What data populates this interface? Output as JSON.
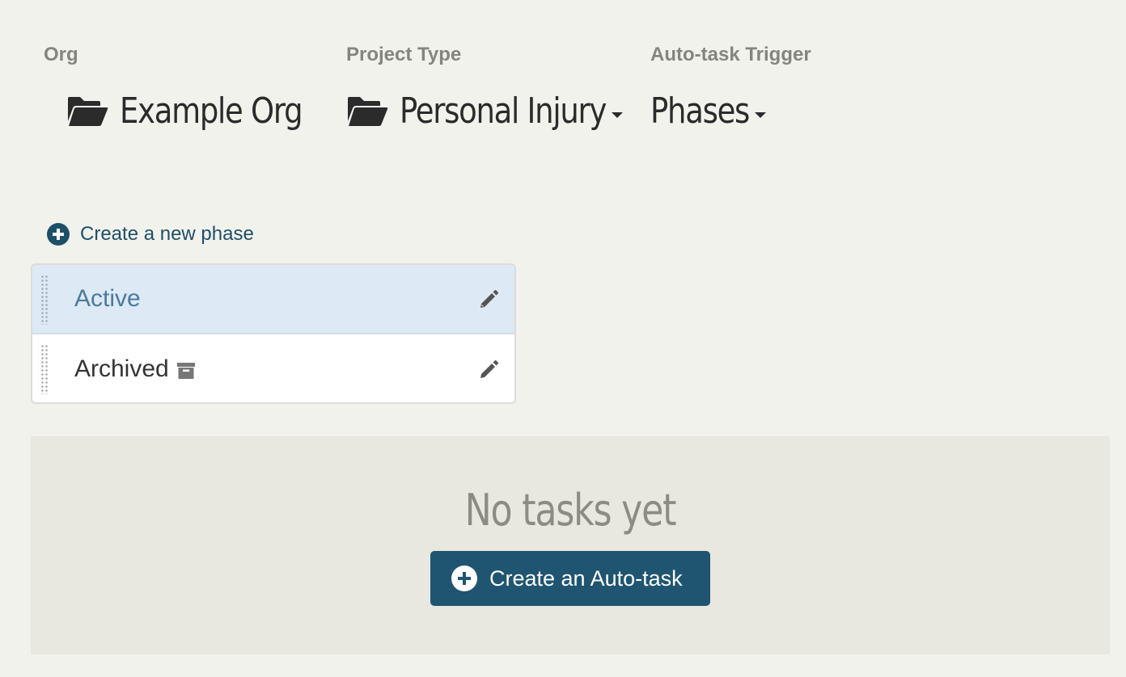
{
  "header": {
    "org": {
      "label": "Org",
      "value": "Example Org",
      "icon": "folder-open-icon"
    },
    "project_type": {
      "label": "Project Type",
      "value": "Personal Injury",
      "icon": "folder-open-icon",
      "dropdown_icon": "caret-down-icon"
    },
    "trigger": {
      "label": "Auto-task Trigger",
      "value": "Phases",
      "dropdown_icon": "caret-down-icon"
    }
  },
  "create_phase": {
    "label": "Create a new phase",
    "icon": "plus-circle-icon"
  },
  "phases": [
    {
      "name": "Active",
      "selected": true,
      "archived": false,
      "edit_icon": "pencil-icon"
    },
    {
      "name": "Archived",
      "selected": false,
      "archived": true,
      "archive_icon": "archive-box-icon",
      "edit_icon": "pencil-icon"
    }
  ],
  "empty_state": {
    "title": "No tasks yet",
    "button_label": "Create an Auto-task",
    "button_icon": "plus-circle-icon"
  },
  "colors": {
    "background": "#f2f2ed",
    "accent": "#1f5570",
    "selected_row": "#dde9f4",
    "selected_text": "#4b7a9b",
    "empty_panel": "#e8e7e0"
  }
}
